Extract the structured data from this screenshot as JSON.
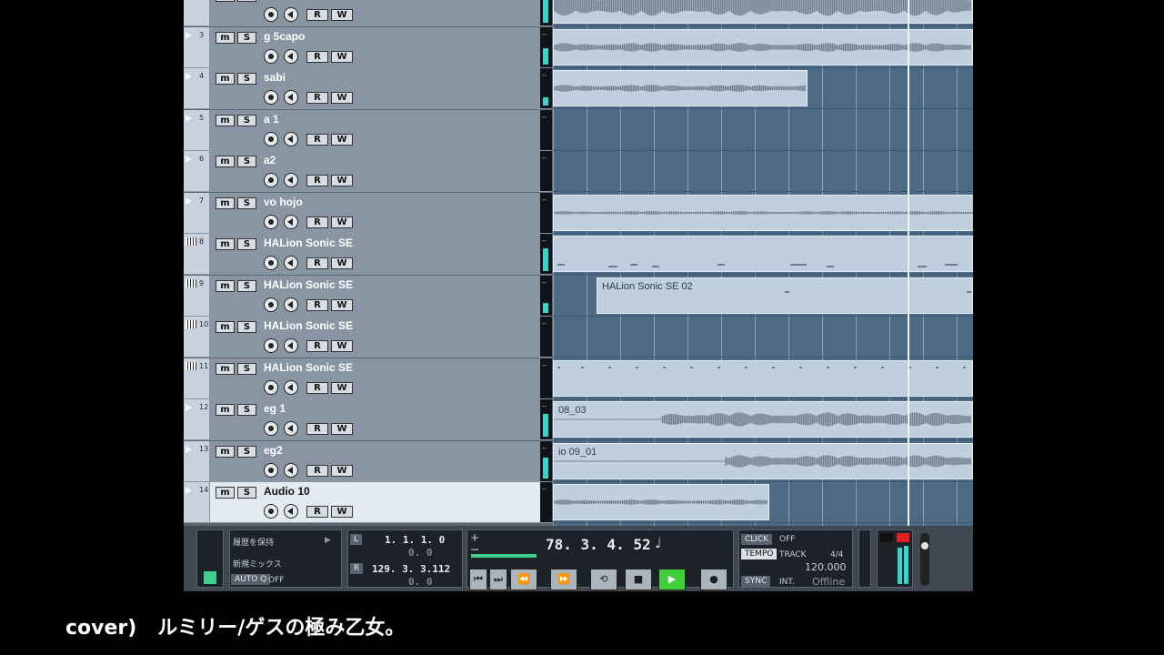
{
  "tracks": [
    {
      "num": "",
      "name": "",
      "kind": "audio",
      "meter": 0.9
    },
    {
      "num": "3",
      "name": "g 5capo",
      "kind": "audio",
      "meter": 0.5
    },
    {
      "num": "4",
      "name": "sabi",
      "kind": "audio",
      "meter": 0.25
    },
    {
      "num": "5",
      "name": "a 1",
      "kind": "audio",
      "meter": 0
    },
    {
      "num": "6",
      "name": "a2",
      "kind": "audio",
      "meter": 0
    },
    {
      "num": "7",
      "name": "vo hojo",
      "kind": "audio",
      "meter": 0
    },
    {
      "num": "8",
      "name": "HALion Sonic SE",
      "kind": "instrument",
      "meter": 0.7
    },
    {
      "num": "9",
      "name": "HALion Sonic SE",
      "kind": "instrument",
      "meter": 0.3
    },
    {
      "num": "10",
      "name": "HALion Sonic SE",
      "kind": "instrument",
      "meter": 0
    },
    {
      "num": "11",
      "name": "HALion Sonic SE",
      "kind": "instrument",
      "meter": 0
    },
    {
      "num": "12",
      "name": "eg 1",
      "kind": "audio",
      "meter": 0.7
    },
    {
      "num": "13",
      "name": "eg2",
      "kind": "audio",
      "meter": 0.65
    },
    {
      "num": "14",
      "name": "Audio 10",
      "kind": "audio",
      "meter": 0,
      "active": true
    }
  ],
  "track_buttons": {
    "mute": "m",
    "solo": "S",
    "read": "R",
    "write": "W"
  },
  "clips": {
    "halion_02": "HALion Sonic SE 02",
    "eg1": "08_03",
    "eg2": "io 09_01"
  },
  "transport": {
    "history_keep": "履歴を保持",
    "new_mix": "新規ミックス",
    "auto_q_label": "AUTO Q",
    "auto_q_value": "OFF",
    "left_label": "L",
    "right_label": "R",
    "left_locator": "1.  1.  1.    0",
    "left_offset": "0.    0",
    "right_locator": "129.  3.  3.112",
    "right_offset": "0.    0",
    "position": "78.  3.  4.  52",
    "plus": "+",
    "minus": "−",
    "click_label": "CLICK",
    "click_value": "OFF",
    "tempo_label": "TEMPO",
    "tempo_mode": "TRACK",
    "signature": "4/4",
    "tempo_value": "120.000",
    "sync_label": "SYNC",
    "sync_mode": "INT.",
    "sync_status": "Offline"
  },
  "caption": "cover)   ルミリー/ゲスの極み乙女。"
}
